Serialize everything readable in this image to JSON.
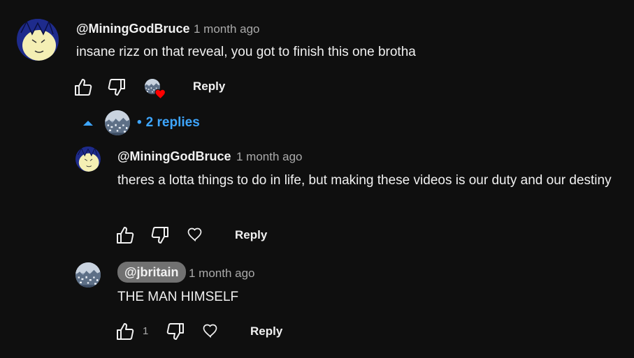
{
  "comment": {
    "author": "@MiningGodBruce",
    "time": "1 month ago",
    "text": "insane rizz on that reveal, you got to finish this one brotha",
    "reply_label": "Reply"
  },
  "replies_toggle": {
    "dot": "•",
    "label": "2 replies"
  },
  "replies": [
    {
      "author": "@MiningGodBruce",
      "time": "1 month ago",
      "text": "theres a lotta things to do in life, but making these videos is our duty and our destiny",
      "reply_label": "Reply"
    },
    {
      "author": "@jbritain",
      "time": "1 month ago",
      "text": "THE MAN HIMSELF",
      "like_count": "1",
      "reply_label": "Reply"
    }
  ],
  "colors": {
    "background": "#0f0f0f",
    "link_blue": "#3ea6ff",
    "heart_red": "#ff0000",
    "chip_gray": "#717171"
  },
  "icons": [
    "thumbs-up-icon",
    "thumbs-down-icon",
    "heart-icon",
    "creator-heart-icon",
    "caret-up-icon"
  ]
}
